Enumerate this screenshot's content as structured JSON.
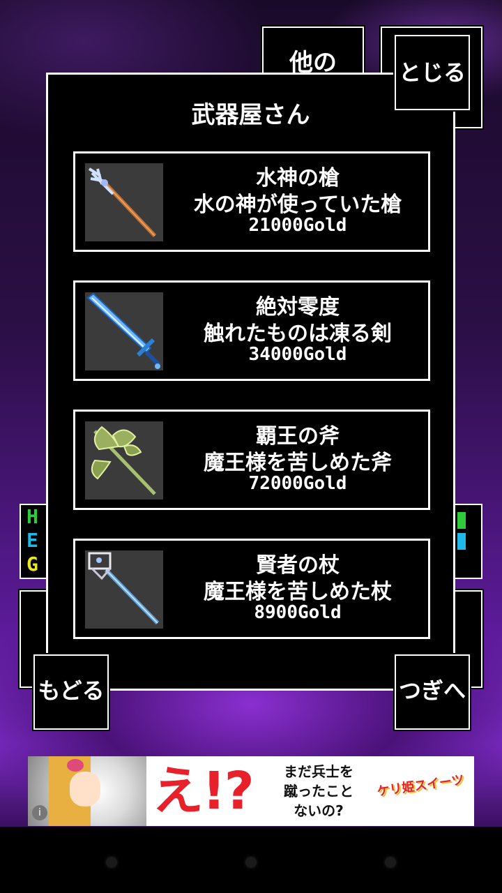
{
  "buttons": {
    "other": "他の",
    "close": "とじる",
    "back": "もどる",
    "next": "つぎへ"
  },
  "side_stats": [
    "H",
    "E",
    "G"
  ],
  "panel": {
    "title": "武器屋さん",
    "items": [
      {
        "name": "水神の槍",
        "desc": "水の神が使っていた槍",
        "price": "21000Gold",
        "icon": "trident-icon"
      },
      {
        "name": "絶対零度",
        "desc": "触れたものは凍る剣",
        "price": "34000Gold",
        "icon": "ice-sword-icon"
      },
      {
        "name": "覇王の斧",
        "desc": "魔王様を苦しめた斧",
        "price": "72000Gold",
        "icon": "battle-axe-icon"
      },
      {
        "name": "賢者の杖",
        "desc": "魔王様を苦しめた杖",
        "price": "8900Gold",
        "icon": "sage-staff-icon"
      }
    ]
  },
  "ad": {
    "exclaim": "え!?",
    "copy_line1": "まだ兵士を",
    "copy_line2": "蹴ったこと",
    "copy_line3": "ないの?",
    "logo": "ケリ姫スイーツ"
  },
  "colors": {
    "accent_red": "#e8202a",
    "stat_green": "#2ecc3a",
    "stat_cyan": "#1fb8e8",
    "stat_yellow": "#e8e81f"
  }
}
